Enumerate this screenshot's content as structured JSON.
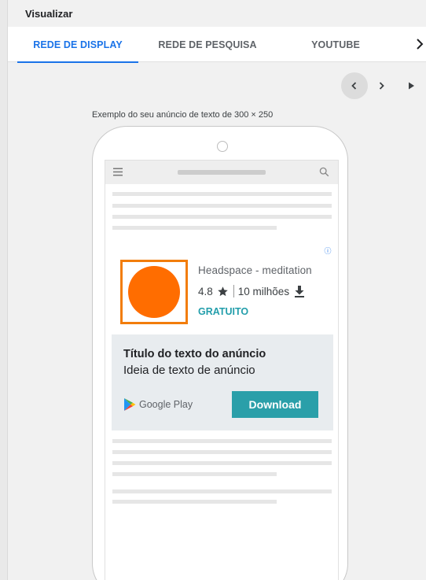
{
  "header": {
    "title": "Visualizar"
  },
  "tabs": [
    {
      "label": "REDE DE DISPLAY",
      "active": true
    },
    {
      "label": "REDE DE PESQUISA",
      "active": false
    },
    {
      "label": "YOUTUBE",
      "active": false
    }
  ],
  "icons": {
    "tabs_more": "chevron-right-icon",
    "prev": "chevron-left-icon",
    "next": "chevron-right-icon",
    "play": "play-icon",
    "menu": "hamburger-menu-icon",
    "search": "search-icon",
    "info": "info-icon",
    "star": "star-icon",
    "download": "download-icon",
    "store_logo": "google-play-logo"
  },
  "preview": {
    "example_label": "Exemplo do seu anúncio de texto de 300 × 250"
  },
  "ad": {
    "info_symbol": "ⓘ",
    "app_name": "Headspace - meditation",
    "rating": "4.8",
    "downloads": "10 milhões",
    "price": "GRATUITO",
    "headline": "Título do texto do anúncio",
    "description": "Ideia de texto de anúncio",
    "store_name": "Google Play",
    "cta_label": "Download"
  },
  "colors": {
    "accent": "#1a73e8",
    "price": "#239eab",
    "cta_background": "#2a9fa9",
    "app_icon": "#ff6d00"
  }
}
